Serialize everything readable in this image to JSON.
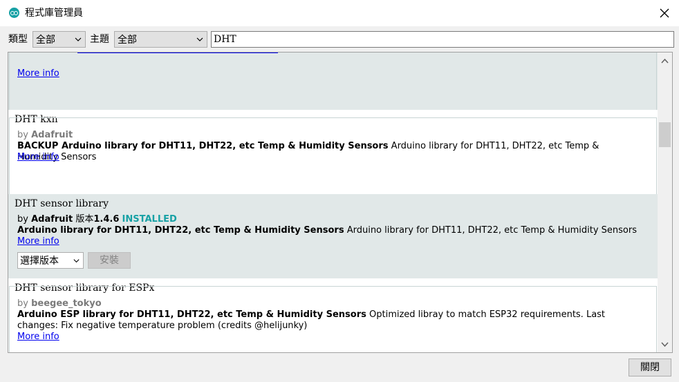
{
  "window": {
    "title": "程式庫管理員"
  },
  "filters": {
    "type_label": "類型",
    "type_value": "全部",
    "topic_label": "主題",
    "topic_value": "全部",
    "search_value": "DHT"
  },
  "libraries": [
    {
      "more_info": "More info"
    },
    {
      "name": "DHT kxn",
      "by": "by",
      "author": "Adafruit",
      "summary": "BACKUP Arduino library for DHT11, DHT22, etc Temp & Humidity Sensors",
      "description": "Arduino library for DHT11, DHT22, etc Temp & Humidity Sensors",
      "more_info": "More info"
    },
    {
      "name": "DHT sensor library",
      "by": "by",
      "author": "Adafruit",
      "version_label": "版本",
      "version": "1.4.6",
      "status": "INSTALLED",
      "summary": "Arduino library for DHT11, DHT22, etc Temp & Humidity Sensors",
      "description": "Arduino library for DHT11, DHT22, etc Temp & Humidity Sensors",
      "more_info": "More info",
      "select_version": "選擇版本",
      "install": "安裝"
    },
    {
      "name": "DHT sensor library for ESPx",
      "by": "by",
      "author": "beegee_tokyo",
      "summary": "Arduino ESP library for DHT11, DHT22, etc Temp & Humidity Sensors",
      "description": "Optimized libray to match ESP32 requirements. Last changes: Fix negative temperature problem (credits @helijunky)",
      "more_info": "More info"
    }
  ],
  "footer": {
    "close_label": "關閉"
  },
  "colors": {
    "accent": "#17a1a5",
    "link": "#0000ee",
    "selected_bg": "#e1e8e8"
  }
}
